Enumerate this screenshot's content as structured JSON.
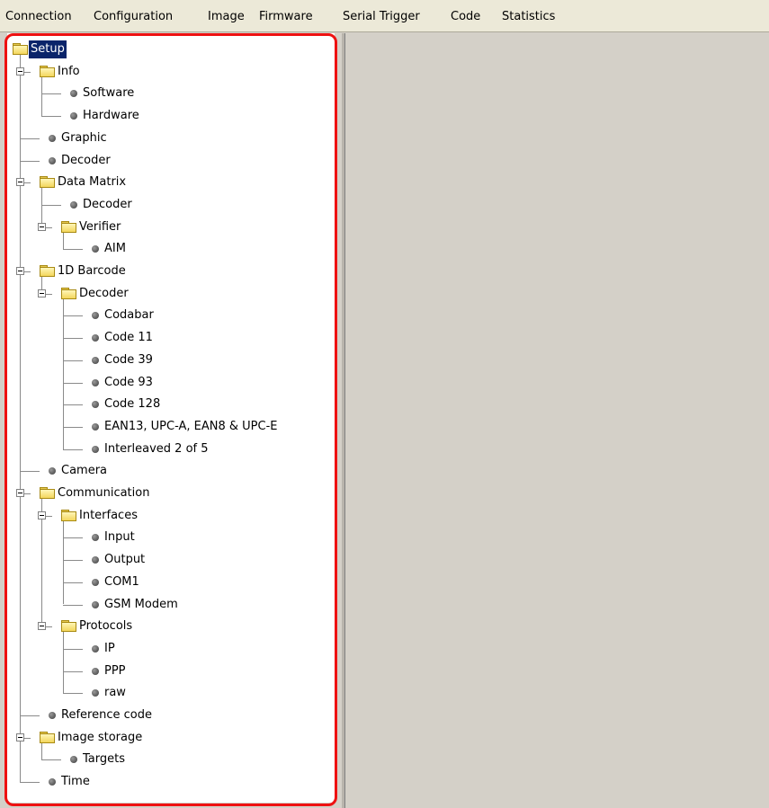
{
  "menubar": {
    "items": [
      {
        "label": "Connection"
      },
      {
        "label": "Configuration"
      },
      {
        "label": "Image"
      },
      {
        "label": "Firmware"
      },
      {
        "label": "Serial Trigger"
      },
      {
        "label": "Code"
      },
      {
        "label": "Statistics"
      }
    ]
  },
  "colors": {
    "window_bg": "#d4d0c8",
    "tree_bg": "#ffffff",
    "selection_bg": "#0a246a",
    "selection_text": "#ffffff",
    "highlight_frame": "#ee1111",
    "folder_fill": "#f3d65c",
    "connector_line": "#8a8a8a"
  },
  "tree": {
    "selected": "Setup",
    "nodes": [
      {
        "label": "Setup",
        "level": 0,
        "kind": "folder",
        "selected": true,
        "expanded": true
      },
      {
        "label": "Info",
        "level": 1,
        "kind": "folder",
        "expanded": true
      },
      {
        "label": "Software",
        "level": 2,
        "kind": "leaf"
      },
      {
        "label": "Hardware",
        "level": 2,
        "kind": "leaf"
      },
      {
        "label": "Graphic",
        "level": 1,
        "kind": "leaf"
      },
      {
        "label": "Decoder",
        "level": 1,
        "kind": "leaf"
      },
      {
        "label": "Data Matrix",
        "level": 1,
        "kind": "folder",
        "expanded": true
      },
      {
        "label": "Decoder",
        "level": 2,
        "kind": "leaf"
      },
      {
        "label": "Verifier",
        "level": 2,
        "kind": "folder",
        "expanded": true
      },
      {
        "label": "AIM",
        "level": 3,
        "kind": "leaf"
      },
      {
        "label": "1D Barcode",
        "level": 1,
        "kind": "folder",
        "expanded": true
      },
      {
        "label": "Decoder",
        "level": 2,
        "kind": "folder",
        "expanded": true
      },
      {
        "label": "Codabar",
        "level": 3,
        "kind": "leaf"
      },
      {
        "label": "Code 11",
        "level": 3,
        "kind": "leaf"
      },
      {
        "label": "Code 39",
        "level": 3,
        "kind": "leaf"
      },
      {
        "label": "Code 93",
        "level": 3,
        "kind": "leaf"
      },
      {
        "label": "Code 128",
        "level": 3,
        "kind": "leaf"
      },
      {
        "label": "EAN13, UPC-A, EAN8 & UPC-E",
        "level": 3,
        "kind": "leaf"
      },
      {
        "label": "Interleaved 2 of 5",
        "level": 3,
        "kind": "leaf"
      },
      {
        "label": "Camera",
        "level": 1,
        "kind": "leaf"
      },
      {
        "label": "Communication",
        "level": 1,
        "kind": "folder",
        "expanded": true
      },
      {
        "label": "Interfaces",
        "level": 2,
        "kind": "folder",
        "expanded": true
      },
      {
        "label": "Input",
        "level": 3,
        "kind": "leaf"
      },
      {
        "label": "Output",
        "level": 3,
        "kind": "leaf"
      },
      {
        "label": "COM1",
        "level": 3,
        "kind": "leaf"
      },
      {
        "label": "GSM Modem",
        "level": 3,
        "kind": "leaf"
      },
      {
        "label": "Protocols",
        "level": 2,
        "kind": "folder",
        "expanded": true
      },
      {
        "label": "IP",
        "level": 3,
        "kind": "leaf"
      },
      {
        "label": "PPP",
        "level": 3,
        "kind": "leaf"
      },
      {
        "label": "raw",
        "level": 3,
        "kind": "leaf"
      },
      {
        "label": "Reference code",
        "level": 1,
        "kind": "leaf"
      },
      {
        "label": "Image storage",
        "level": 1,
        "kind": "folder",
        "expanded": true
      },
      {
        "label": "Targets",
        "level": 2,
        "kind": "leaf"
      },
      {
        "label": "Time",
        "level": 1,
        "kind": "leaf"
      }
    ]
  }
}
